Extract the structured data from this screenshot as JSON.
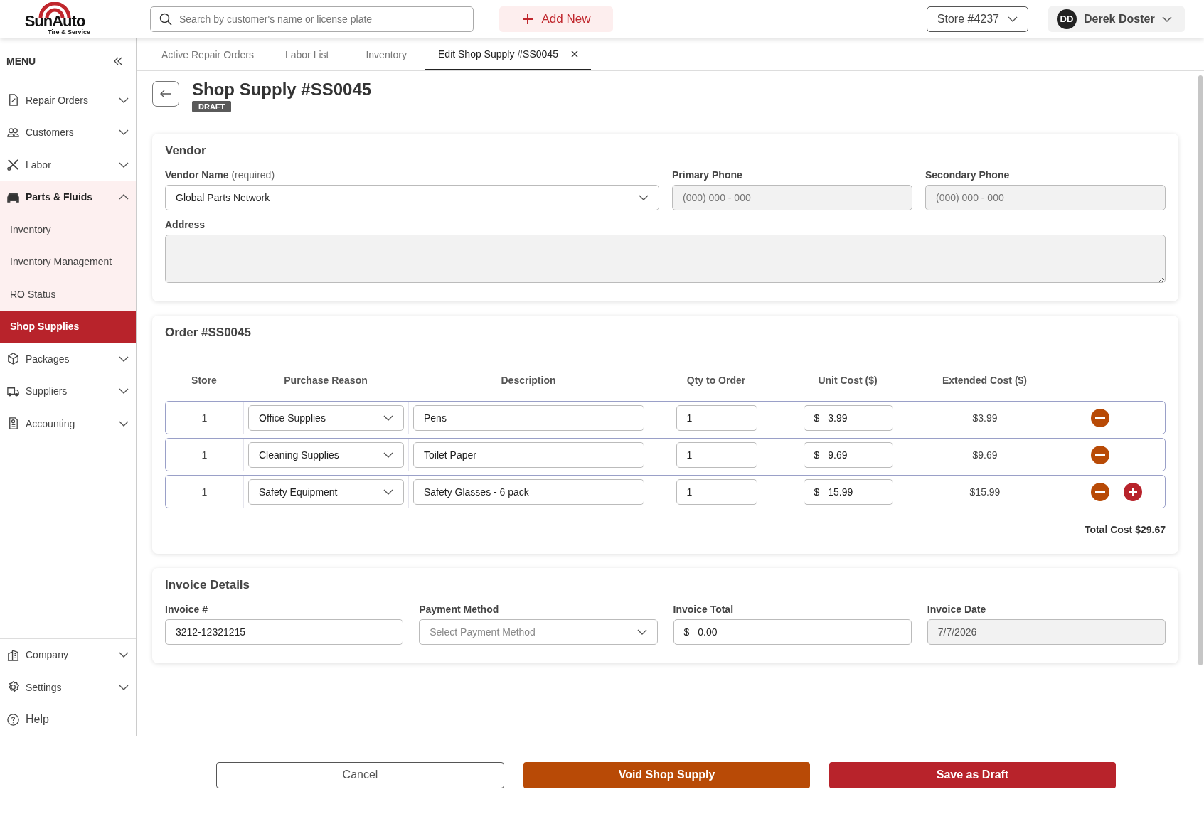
{
  "header": {
    "logo": {
      "name": "SunAuto",
      "tagline": "Tire & Service"
    },
    "search": {
      "placeholder": "Search by customer's name or license plate"
    },
    "add_button": "Add New",
    "store": "Store #4237",
    "user": {
      "initials": "DD",
      "name": "Derek Doster"
    }
  },
  "sidebar": {
    "title": "MENU",
    "items": [
      {
        "label": "Repair Orders",
        "expanded": false
      },
      {
        "label": "Customers",
        "expanded": false
      },
      {
        "label": "Labor",
        "expanded": false
      },
      {
        "label": "Parts & Fluids",
        "expanded": true,
        "children": [
          {
            "label": "Inventory",
            "selected": false
          },
          {
            "label": "Inventory Management",
            "selected": false
          },
          {
            "label": "RO Status",
            "selected": false
          },
          {
            "label": "Shop Supplies",
            "selected": true
          }
        ]
      },
      {
        "label": "Packages",
        "expanded": false
      },
      {
        "label": "Suppliers",
        "expanded": false
      },
      {
        "label": "Accounting",
        "expanded": false
      }
    ],
    "bottom_items": [
      {
        "label": "Company",
        "kind": "group",
        "expanded": false
      },
      {
        "label": "Settings",
        "kind": "group",
        "expanded": false
      },
      {
        "label": "Help",
        "kind": "link"
      }
    ]
  },
  "tabs": [
    {
      "label": "Active Repair Orders",
      "selected": false,
      "closable": false
    },
    {
      "label": "Labor List",
      "selected": false,
      "closable": false
    },
    {
      "label": "Inventory",
      "selected": false,
      "closable": false
    },
    {
      "label": "Edit Shop Supply #SS0045",
      "selected": true,
      "closable": true
    }
  ],
  "page": {
    "title": "Shop Supply #SS0045",
    "status": "DRAFT"
  },
  "vendor": {
    "title": "Vendor",
    "name_label": "Vendor Name",
    "name_hint": "(required)",
    "name_value": "Global Parts Network",
    "primary_phone": {
      "label": "Primary Phone",
      "placeholder": "(000) 000 - 000"
    },
    "secondary_phone": {
      "label": "Secondary Phone",
      "placeholder": "(000) 000 - 000"
    },
    "address_label": "Address"
  },
  "order": {
    "title": "Order #SS0045",
    "columns": [
      "Store",
      "Purchase Reason",
      "Description",
      "Qty to Order",
      "Unit Cost ($)",
      "Extended Cost ($)"
    ],
    "rows": [
      {
        "store": "1",
        "reason": "Office Supplies",
        "description": "Pens",
        "qty": "1",
        "unit_cost": "3.99",
        "extended_cost": "$3.99",
        "can_add": false
      },
      {
        "store": "1",
        "reason": "Cleaning Supplies",
        "description": "Toilet Paper",
        "qty": "1",
        "unit_cost": "9.69",
        "extended_cost": "$9.69",
        "can_add": false
      },
      {
        "store": "1",
        "reason": "Safety Equipment",
        "description": "Safety Glasses - 6 pack",
        "qty": "1",
        "unit_cost": "15.99",
        "extended_cost": "$15.99",
        "can_add": true
      }
    ],
    "currency": "$",
    "total": "Total Cost $29.67"
  },
  "invoice": {
    "title": "Invoice Details",
    "fields": [
      {
        "label": "Invoice #",
        "kind": "text",
        "value": "3212-12321215"
      },
      {
        "label": "Payment Method",
        "kind": "select",
        "placeholder": "Select Payment Method"
      },
      {
        "label": "Invoice Total",
        "kind": "money",
        "prefix": "$",
        "value": "0.00"
      },
      {
        "label": "Invoice Date",
        "kind": "readonly",
        "value": "7/7/2026"
      }
    ]
  },
  "footer": {
    "cancel": "Cancel",
    "void": "Void Shop Supply",
    "save": "Save as Draft"
  }
}
